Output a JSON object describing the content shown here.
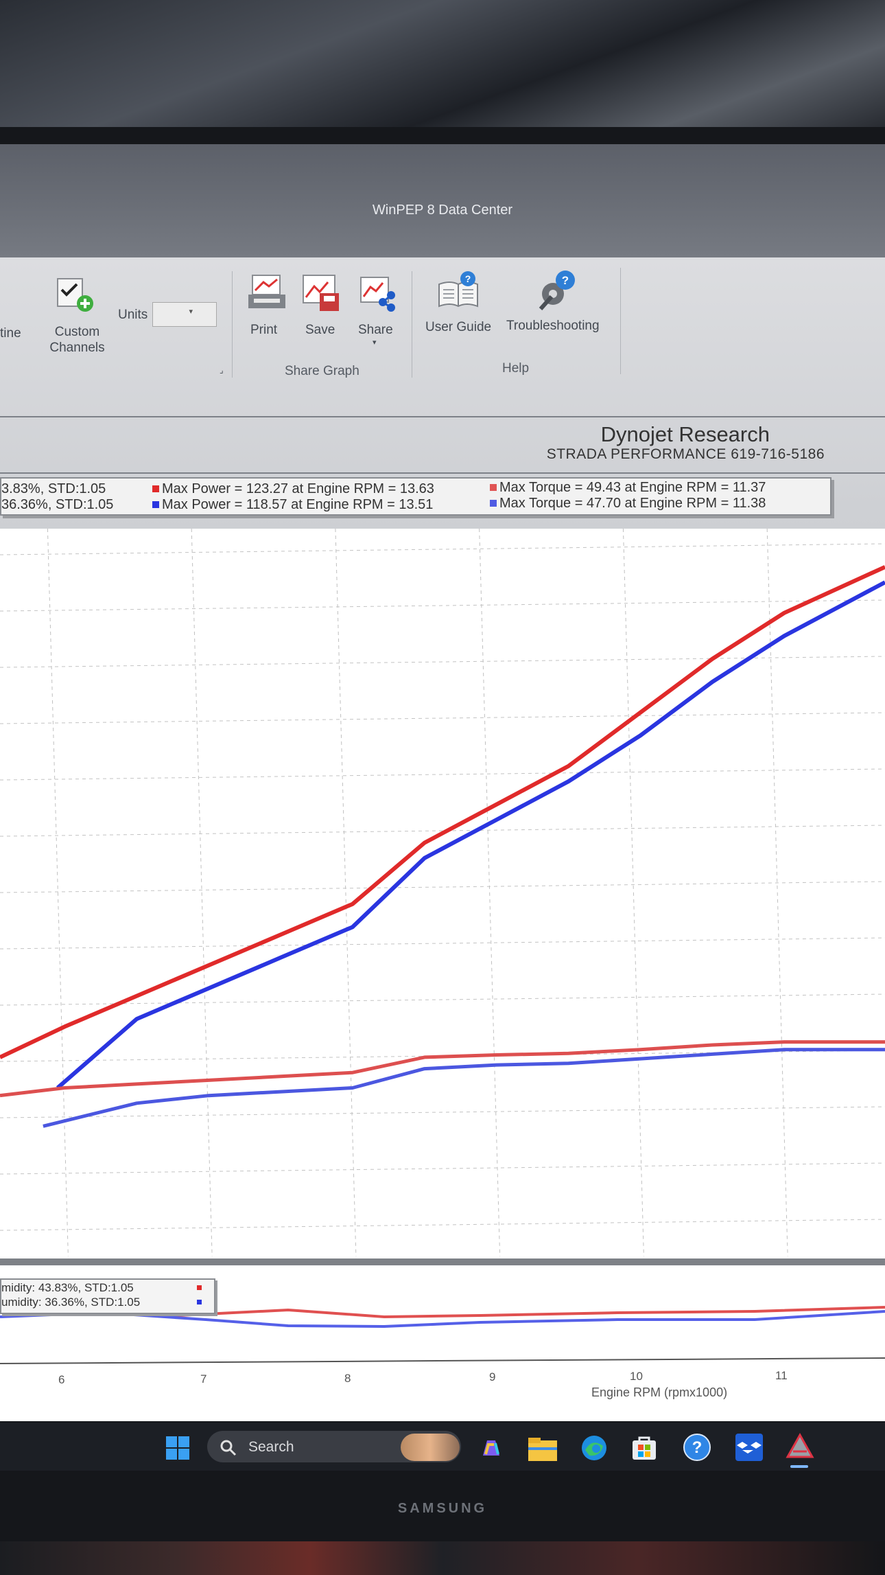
{
  "window": {
    "title": "WinPEP 8 Data Center"
  },
  "ribbon": {
    "partial_left_label": "tine",
    "custom_channels_label": "Custom Channels",
    "units_label": "Units",
    "units_value": "",
    "print_label": "Print",
    "save_label": "Save",
    "share_label": "Share",
    "share_graph_group": "Share Graph",
    "user_guide_label": "User Guide",
    "troubleshooting_label": "Troubleshooting",
    "help_group": "Help"
  },
  "report": {
    "company": "Dynojet Research",
    "subline": "STRADA PERFORMANCE  619-716-5186"
  },
  "legend": {
    "run1_conditions": "3.83%, STD:1.05",
    "run2_conditions": "36.36%, STD:1.05",
    "run1_power": "Max Power = 123.27 at Engine RPM = 13.63",
    "run2_power": "Max Power = 118.57 at Engine RPM = 13.51",
    "run1_torque": "Max Torque = 49.43 at Engine RPM = 11.37",
    "run2_torque": "Max Torque = 47.70 at Engine RPM = 11.38",
    "run1_color": "#e02a2a",
    "run2_color": "#2a35e0"
  },
  "lower_legend": {
    "run1": "midity: 43.83%, STD:1.05",
    "run2": "umidity: 36.36%, STD:1.05"
  },
  "chart_data": {
    "type": "line",
    "xlabel": "Engine RPM (rpmx1000)",
    "x_ticks": [
      "6",
      "7",
      "8",
      "9",
      "10",
      "11"
    ],
    "series": [
      {
        "name": "Max Power = 123.27 at Engine RPM = 13.63",
        "color": "#e02a2a",
        "x": [
          5.55,
          6.0,
          6.5,
          7.0,
          7.5,
          8.0,
          8.5,
          9.0,
          9.5,
          10.0,
          10.5,
          11.0,
          11.7
        ],
        "y": [
          46,
          50,
          54,
          58,
          62,
          66,
          74,
          79,
          84,
          91,
          98,
          104,
          110
        ]
      },
      {
        "name": "Max Power = 118.57 at Engine RPM = 13.51",
        "color": "#2a35e0",
        "x": [
          5.95,
          6.5,
          7.0,
          7.5,
          8.0,
          8.5,
          9.0,
          9.5,
          10.0,
          10.5,
          11.0,
          11.7
        ],
        "y": [
          42,
          51,
          55,
          59,
          63,
          72,
          77,
          82,
          88,
          95,
          101,
          108
        ]
      },
      {
        "name": "Max Torque = 49.43 at Engine RPM = 11.37",
        "color": "#dd4f4f",
        "x": [
          5.55,
          6.0,
          6.5,
          7.0,
          7.5,
          8.0,
          8.5,
          9.0,
          9.5,
          10.0,
          10.5,
          11.0,
          11.7
        ],
        "y": [
          41,
          42,
          42.5,
          43,
          43.5,
          44,
          46,
          46.3,
          46.5,
          47,
          47.6,
          48,
          48
        ]
      },
      {
        "name": "Max Torque = 47.70 at Engine RPM = 11.38",
        "color": "#4b57e0",
        "x": [
          5.85,
          6.5,
          7.0,
          7.5,
          8.0,
          8.5,
          9.0,
          9.5,
          10.0,
          10.5,
          11.0,
          11.7
        ],
        "y": [
          37,
          40,
          41,
          41.5,
          42,
          44.5,
          45,
          45.2,
          45.8,
          46.4,
          47,
          47
        ]
      }
    ]
  }
}
